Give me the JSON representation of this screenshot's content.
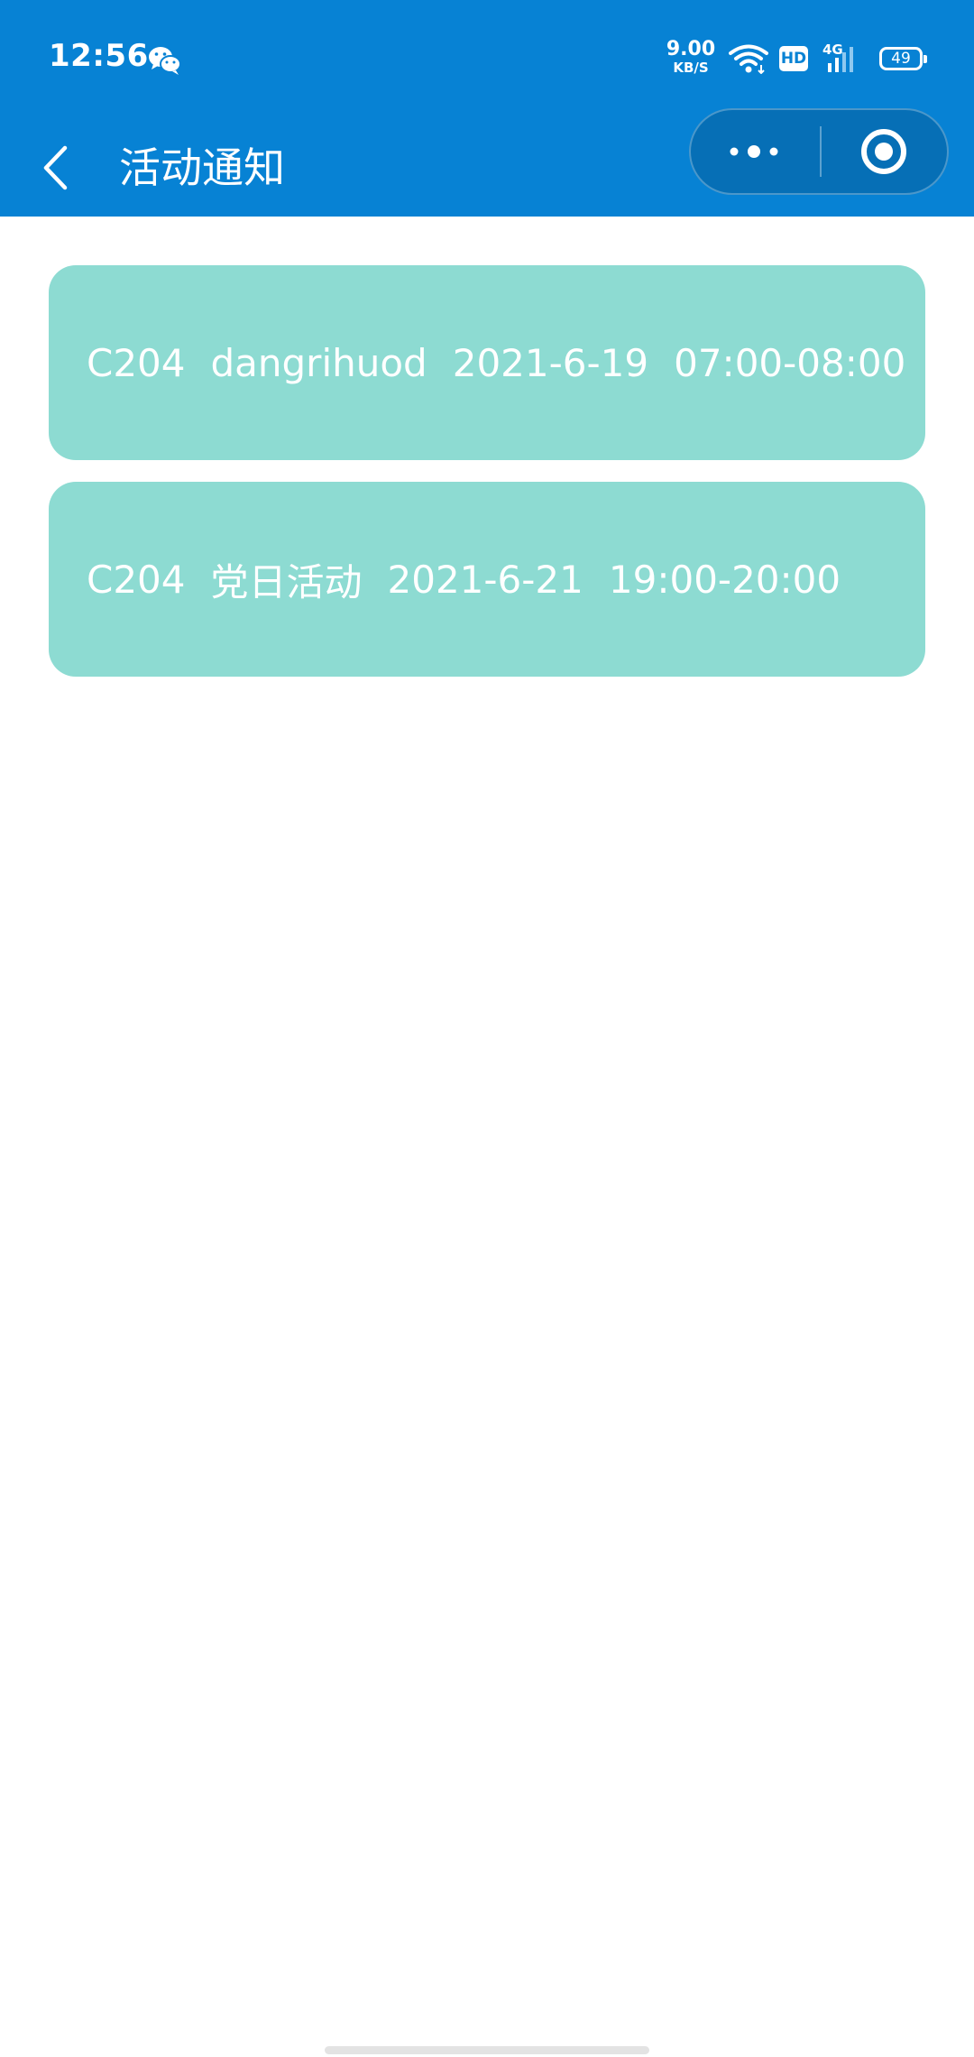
{
  "status_bar": {
    "time": "12:56",
    "net_speed_value": "9.00",
    "net_speed_unit": "KB/S",
    "hd_label": "HD",
    "network_type": "4G",
    "battery_level": "49",
    "icons": [
      "wechat-icon",
      "wifi-icon",
      "hd-icon",
      "signal-icon",
      "battery-icon"
    ]
  },
  "nav": {
    "title": "活动通知",
    "back_icon": "chevron-left-icon",
    "capsule_icons": [
      "more-dots-icon",
      "close-target-icon"
    ]
  },
  "notices": [
    {
      "room": "C204",
      "name": "dangrihuod",
      "date": "2021-6-19",
      "time": "07:00-08:00"
    },
    {
      "room": "C204",
      "name": "党日活动",
      "date": "2021-6-21",
      "time": "19:00-20:00"
    }
  ],
  "colors": {
    "header": "#0782d4",
    "card": "#8ddbd2",
    "card_text": "#ffffff",
    "background": "#ffffff"
  }
}
